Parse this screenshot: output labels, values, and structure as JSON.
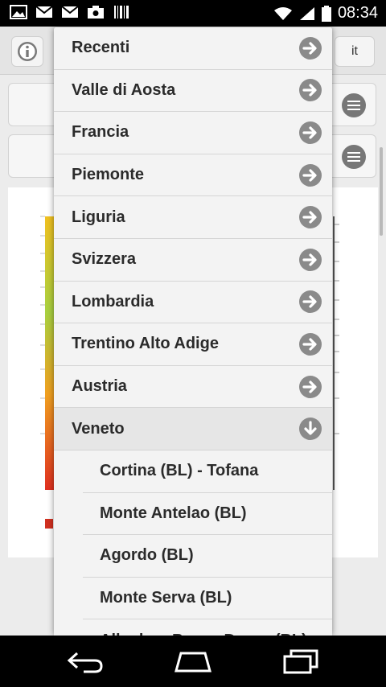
{
  "status_bar": {
    "time": "08:34",
    "icons": [
      "image-icon",
      "mail-icon",
      "mail-icon",
      "camera-icon",
      "barcode-icon",
      "wifi-icon",
      "signal-icon",
      "battery-icon"
    ]
  },
  "toolbar": {
    "language_label": "it"
  },
  "dropdown": {
    "regions": [
      {
        "label": "Recenti",
        "expanded": false
      },
      {
        "label": "Valle di Aosta",
        "expanded": false
      },
      {
        "label": "Francia",
        "expanded": false
      },
      {
        "label": "Piemonte",
        "expanded": false
      },
      {
        "label": "Liguria",
        "expanded": false
      },
      {
        "label": "Svizzera",
        "expanded": false
      },
      {
        "label": "Lombardia",
        "expanded": false
      },
      {
        "label": "Trentino Alto Adige",
        "expanded": false
      },
      {
        "label": "Austria",
        "expanded": false
      },
      {
        "label": "Veneto",
        "expanded": true
      }
    ],
    "veneto_stations": [
      {
        "label": "Cortina (BL) - Tofana"
      },
      {
        "label": "Monte Antelao (BL)"
      },
      {
        "label": "Agordo (BL)"
      },
      {
        "label": "Monte Serva (BL)"
      },
      {
        "label": "Alleghe - Passo Duran (BL)"
      }
    ]
  },
  "colors": {
    "arrow_circle": "#8a8a8a",
    "status_bar": "#000000",
    "nav_bar": "#000000"
  }
}
